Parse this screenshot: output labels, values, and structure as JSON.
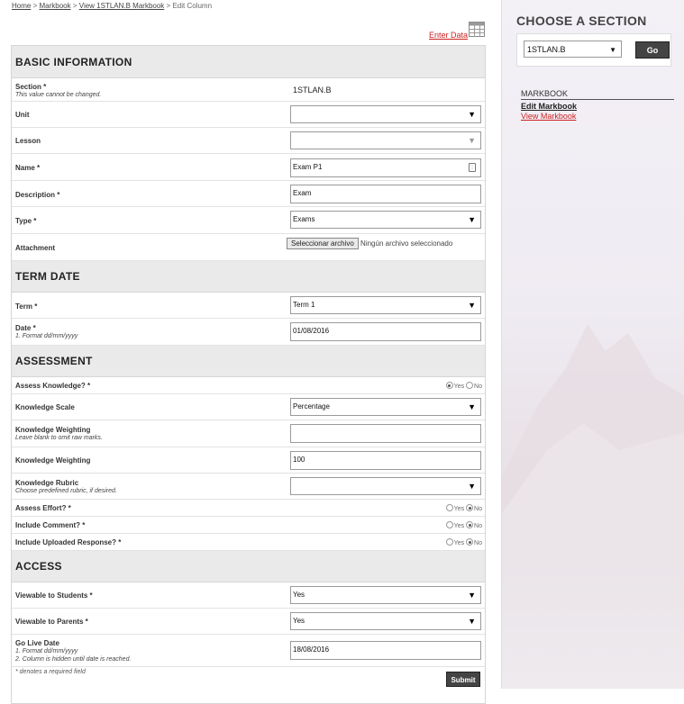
{
  "breadcrumb": {
    "home": "Home",
    "markbook": "Markbook",
    "view": "View 1STLAN.B Markbook",
    "current": "Edit Column",
    "sep": ">"
  },
  "enter_data": "Enter Data",
  "sidebar": {
    "title": "CHOOSE A SECTION",
    "section_value": "1STLAN.B",
    "go_label": "Go",
    "markbook_header": "MARKBOOK",
    "edit_markbook": "Edit Markbook",
    "view_markbook": "View Markbook"
  },
  "basic": {
    "title": "BASIC INFORMATION",
    "section_label": "Section *",
    "section_sub": "This value cannot be changed.",
    "section_value": "1STLAN.B",
    "unit_label": "Unit",
    "unit_value": "",
    "lesson_label": "Lesson",
    "lesson_value": "",
    "name_label": "Name *",
    "name_value": "Exam P1",
    "description_label": "Description *",
    "description_value": "Exam",
    "type_label": "Type *",
    "type_value": "Exams",
    "attachment_label": "Attachment",
    "file_button": "Seleccionar archivo",
    "file_status": "Ningún archivo seleccionado"
  },
  "term": {
    "title": "TERM DATE",
    "term_label": "Term *",
    "term_value": "Term 1",
    "date_label": "Date *",
    "date_sub": "1. Format dd/mm/yyyy",
    "date_value": "01/08/2016"
  },
  "assessment": {
    "title": "ASSESSMENT",
    "assess_knowledge_label": "Assess Knowledge? *",
    "yes": "Yes",
    "no": "No",
    "knowledge_scale_label": "Knowledge Scale",
    "knowledge_scale_value": "Percentage",
    "kw_raw_label": "Knowledge Weighting",
    "kw_raw_sub": "Leave blank to omit raw marks.",
    "kw_raw_value": "",
    "kw_label": "Knowledge Weighting",
    "kw_value": "100",
    "rubric_label": "Knowledge Rubric",
    "rubric_sub": "Choose predefined rubric, if desired.",
    "rubric_value": "",
    "effort_label": "Assess Effort? *",
    "comment_label": "Include Comment? *",
    "uploaded_label": "Include Uploaded Response? *"
  },
  "access": {
    "title": "ACCESS",
    "students_label": "Viewable to Students *",
    "students_value": "Yes",
    "parents_label": "Viewable to Parents *",
    "parents_value": "Yes",
    "golive_label": "Go Live Date",
    "golive_sub1": "1. Format dd/mm/yyyy",
    "golive_sub2": "2. Column is hidden until date is reached.",
    "golive_value": "18/08/2016"
  },
  "footer": {
    "required_note": "* denotes a required field",
    "submit_label": "Submit"
  }
}
